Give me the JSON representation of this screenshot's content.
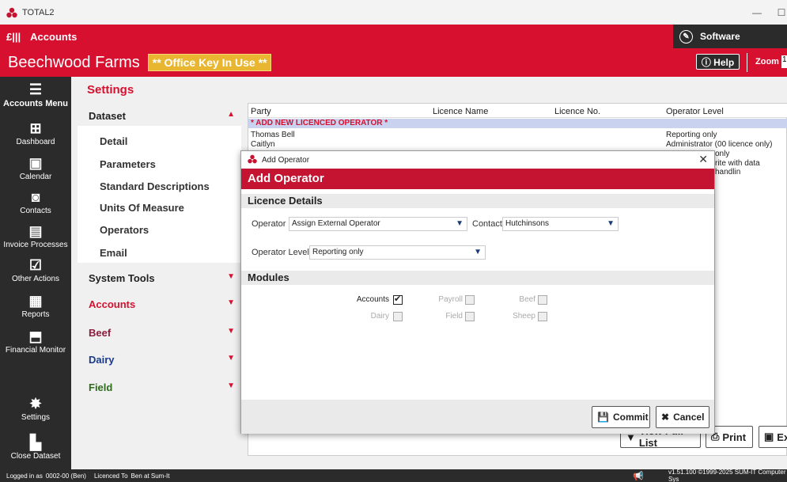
{
  "window": {
    "title": "TOTAL2",
    "minimize": "—",
    "maximize": "☐"
  },
  "topbar": {
    "module": "Accounts",
    "software": "Software"
  },
  "farmbar": {
    "farm_name": "Beechwood Farms",
    "key_badge": "** Office Key In Use **",
    "help": "ⓘ Help",
    "zoom_label": "Zoom",
    "zoom_value": "1"
  },
  "nav": {
    "menu": "Accounts Menu",
    "items": [
      {
        "label": "Dashboard"
      },
      {
        "label": "Calendar"
      },
      {
        "label": "Contacts"
      },
      {
        "label": "Invoice Processes"
      },
      {
        "label": "Other Actions"
      },
      {
        "label": "Reports"
      },
      {
        "label": "Financial Monitor"
      },
      {
        "label": "Settings"
      },
      {
        "label": "Close Dataset"
      }
    ]
  },
  "settings": {
    "heading": "Settings",
    "sections": [
      {
        "label": "Dataset",
        "open": true
      },
      {
        "label": "System Tools"
      },
      {
        "label": "Accounts"
      },
      {
        "label": "Beef"
      },
      {
        "label": "Dairy"
      },
      {
        "label": "Field"
      }
    ],
    "dataset_items": [
      "Detail",
      "Parameters",
      "Standard Descriptions",
      "Units Of Measure",
      "Operators",
      "Email"
    ]
  },
  "grid": {
    "headers": [
      "Party",
      "Licence Name",
      "Licence No.",
      "Operator Level"
    ],
    "add_row": "* ADD NEW LICENCED OPERATOR *",
    "rows": [
      {
        "party": "Thomas Bell",
        "level": "Reporting only"
      },
      {
        "party": "Caitlyn",
        "level": "Administrator (00 licence only)"
      },
      {
        "party": "",
        "level": "only"
      },
      {
        "party": "",
        "level": "rite with data handlin"
      }
    ],
    "view_full_list": "View Full List",
    "print": "Print",
    "export": "Ex"
  },
  "modal": {
    "window_title": "Add Operator",
    "heading": "Add Operator",
    "licence_section": "Licence Details",
    "operator_label": "Operator",
    "operator_value": "Assign External Operator",
    "contact_label": "Contact",
    "contact_value": "Hutchinsons",
    "level_label": "Operator Level",
    "level_value": "Reporting only",
    "modules_section": "Modules",
    "modules": [
      {
        "label": "Accounts",
        "checked": true
      },
      {
        "label": "Payroll",
        "checked": false
      },
      {
        "label": "Beef",
        "checked": false
      },
      {
        "label": "Dairy",
        "checked": false
      },
      {
        "label": "Field",
        "checked": false
      },
      {
        "label": "Sheep",
        "checked": false
      }
    ],
    "commit": "Commit",
    "cancel": "Cancel"
  },
  "footer": {
    "logged_in_label": "Logged in as",
    "logged_in_value": "0002-00 (Ben)",
    "licenced_label": "Licenced To",
    "licenced_value": "Ben at Sum-It",
    "version": "v1.51.100 ©1999-2025 SUM-IT Computer Sys"
  },
  "colors": {
    "brand_red": "#d8102f",
    "dark": "#2b2b2b",
    "badge": "#e8b630",
    "modal_red": "#c41431"
  }
}
